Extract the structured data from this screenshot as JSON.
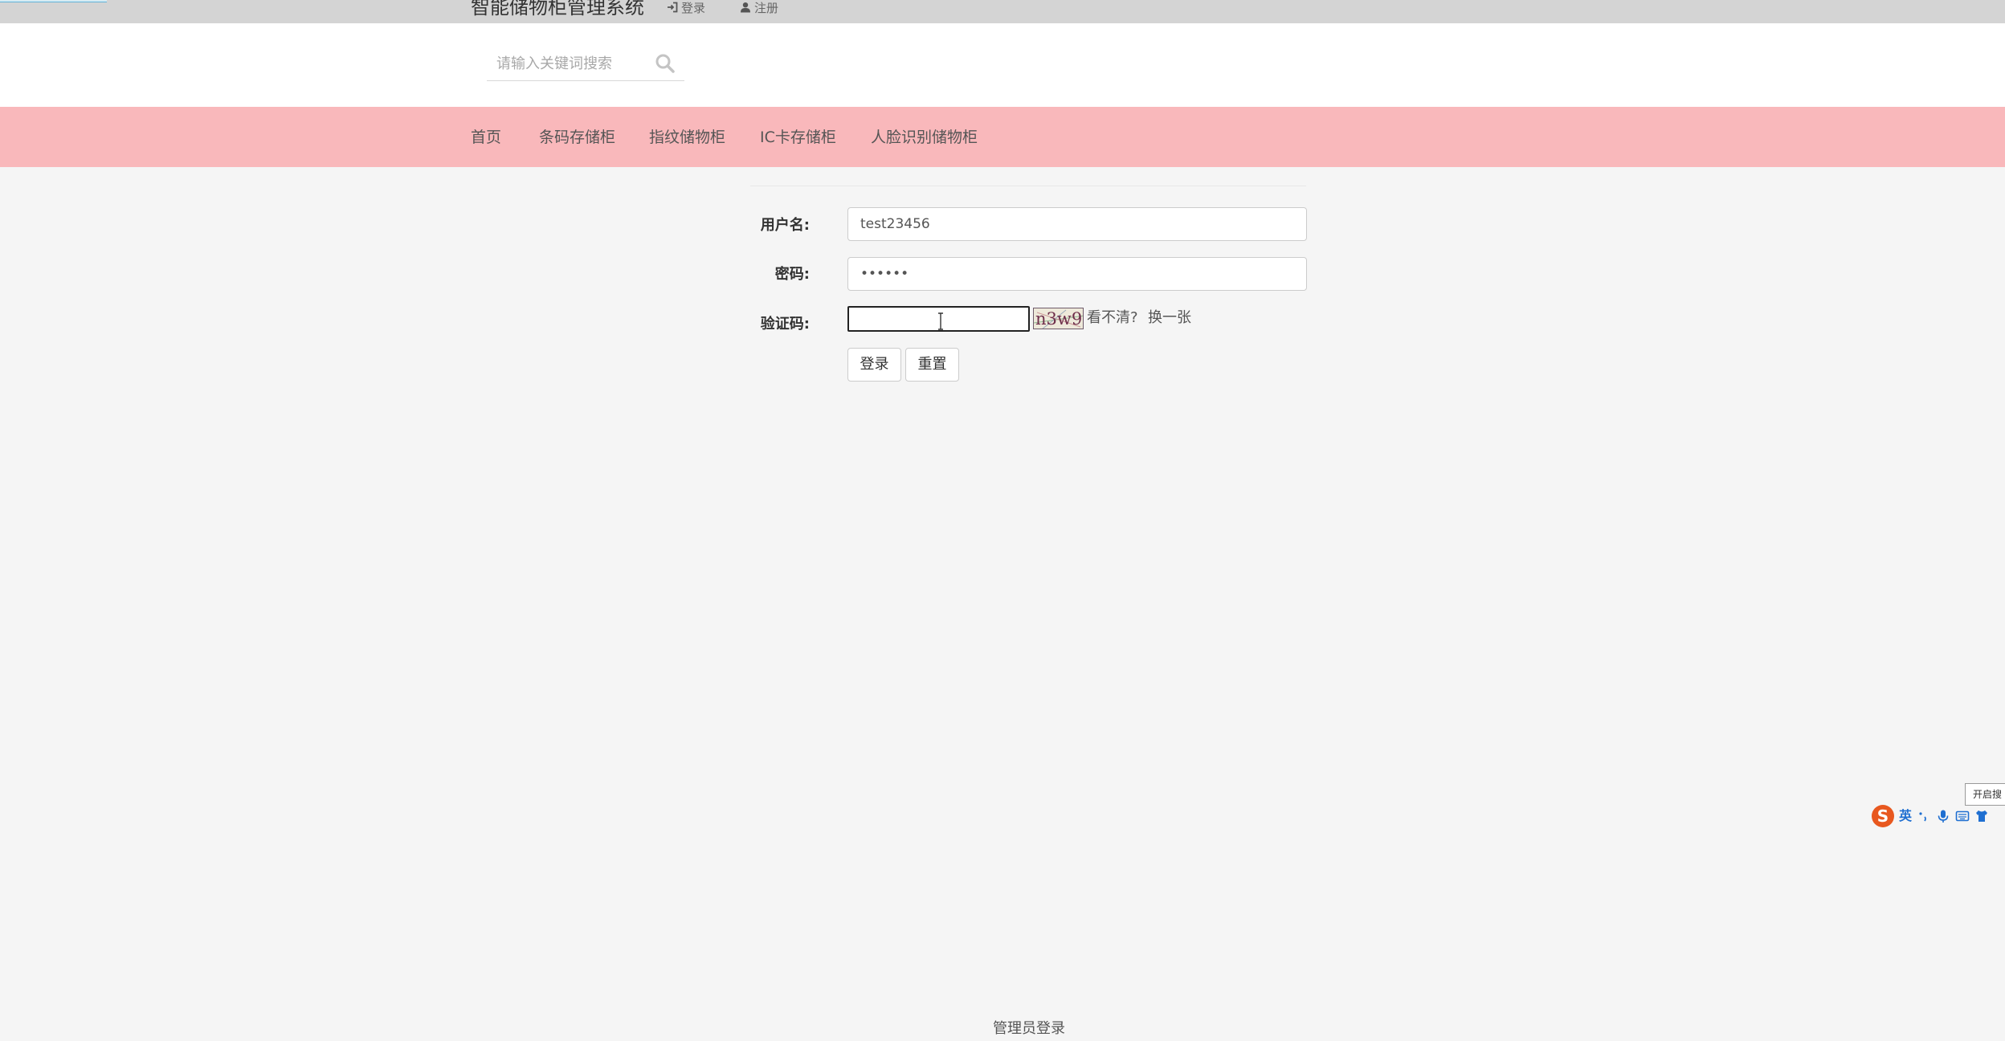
{
  "topbar": {
    "site_title": "智能储物柜管理系统",
    "login_label": "登录",
    "register_label": "注册"
  },
  "search": {
    "placeholder": "请输入关键词搜索",
    "value": ""
  },
  "nav": {
    "items": [
      {
        "label": "首页"
      },
      {
        "label": "条码存储柜"
      },
      {
        "label": "指纹储物柜"
      },
      {
        "label": "IC卡存储柜"
      },
      {
        "label": "人脸识别储物柜"
      }
    ]
  },
  "login_form": {
    "username_label": "用户名:",
    "username_value": "test23456",
    "password_label": "密码:",
    "password_value": "••••••",
    "captcha_label": "验证码:",
    "captcha_value": "",
    "captcha_image_text": "n3w9",
    "captcha_unclear": "看不清?",
    "captcha_refresh": "换一张",
    "login_button": "登录",
    "reset_button": "重置"
  },
  "ime": {
    "tooltip": "开启搜",
    "logo": "S",
    "lang": "英",
    "icons": [
      "punctuation-icon",
      "microphone-icon",
      "keyboard-icon",
      "skin-icon"
    ]
  },
  "footer": {
    "admin_login": "管理员登录"
  },
  "colors": {
    "topbar_bg": "#d4d4d4",
    "nav_bg": "#f9b8bb",
    "page_bg": "#f5f5f5",
    "ime_brand": "#e8581f",
    "ime_accent": "#1f6fd1"
  }
}
